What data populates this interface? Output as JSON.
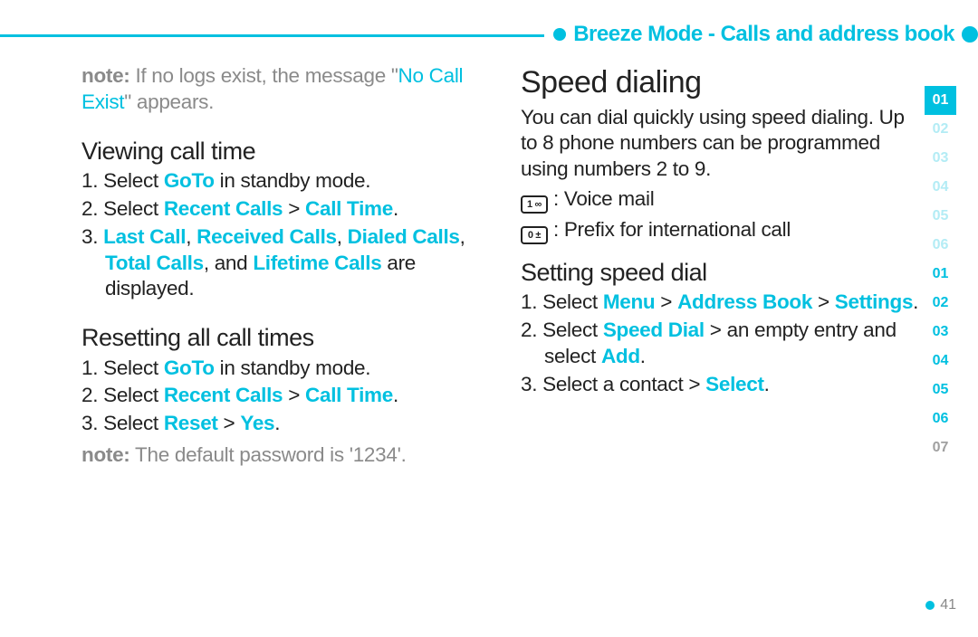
{
  "header": {
    "title": "Breeze Mode - Calls and address book"
  },
  "left": {
    "note1_prefix": "note:",
    "note1_text1": " If no logs exist, the message \"",
    "note1_hl": "No Call Exist",
    "note1_text2": "\" appears.",
    "h1": "Viewing call time",
    "h1_items": {
      "i1_num": "1. ",
      "i1_a": "Select ",
      "i1_b": "GoTo",
      "i1_c": " in standby mode.",
      "i2_num": "2. ",
      "i2_a": "Select ",
      "i2_b": "Recent Calls",
      "i2_gt": " > ",
      "i2_c": "Call Time",
      "i2_d": ".",
      "i3_num": "3. ",
      "i3_a": "Last Call",
      "i3_s1": ", ",
      "i3_b": "Received Calls",
      "i3_s2": ", ",
      "i3_c": "Dialed Calls",
      "i3_s3": ", ",
      "i3_d": "Total Calls",
      "i3_s4": ", and ",
      "i3_e": "Lifetime Calls",
      "i3_f": " are displayed."
    },
    "h2": "Resetting all call times",
    "h2_items": {
      "i1_num": "1. ",
      "i1_a": "Select ",
      "i1_b": "GoTo",
      "i1_c": " in standby mode.",
      "i2_num": "2. ",
      "i2_a": "Select ",
      "i2_b": "Recent Calls",
      "i2_gt": " > ",
      "i2_c": "Call Time",
      "i2_d": ".",
      "i3_num": "3. ",
      "i3_a": "Select ",
      "i3_b": "Reset",
      "i3_gt": " > ",
      "i3_c": "Yes",
      "i3_d": "."
    },
    "note2_prefix": "note:",
    "note2_text": " The default password is '1234'."
  },
  "right": {
    "h0": "Speed dialing",
    "p1": "You can dial quickly using speed dialing. Up to 8 phone numbers can be programmed using numbers 2 to 9.",
    "glyph1": "1 ∞",
    "glyph1_text": " : Voice mail",
    "glyph2": "0 ±",
    "glyph2_text": " : Prefix for international call",
    "h1": "Setting speed dial",
    "h1_items": {
      "i1_num": "1. ",
      "i1_a": "Select ",
      "i1_b": "Menu",
      "i1_gt1": " > ",
      "i1_c": "Address Book",
      "i1_gt2": " > ",
      "i1_d": "Settings",
      "i1_e": ".",
      "i2_num": "2. ",
      "i2_a": "Select ",
      "i2_b": "Speed Dial",
      "i2_c": " > an empty entry and select ",
      "i2_d": "Add",
      "i2_e": ".",
      "i3_num": "3. ",
      "i3_a": "Select a contact > ",
      "i3_b": "Select",
      "i3_c": "."
    }
  },
  "sidebar": [
    "01",
    "02",
    "03",
    "04",
    "05",
    "06",
    "01",
    "02",
    "03",
    "04",
    "05",
    "06",
    "07"
  ],
  "page_number": "41"
}
